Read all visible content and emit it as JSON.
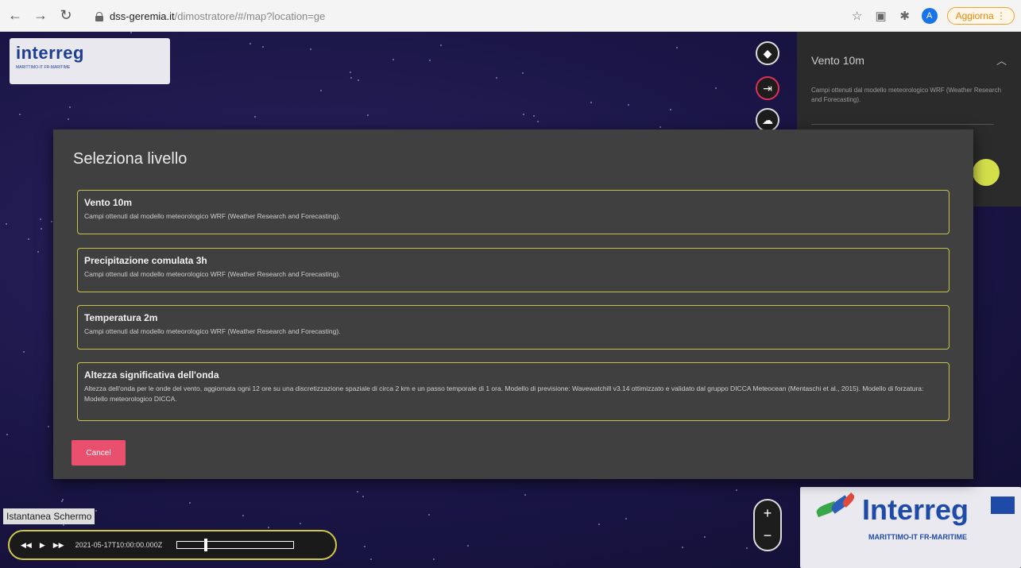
{
  "browser": {
    "url_host": "dss-geremia.it",
    "url_path": "/dimostratore/#/map?location=ge",
    "profile_initial": "A",
    "update_label": "Aggiorna"
  },
  "logo": {
    "small_word": "interreg",
    "small_sub": "MARITTIMO-IT FR-MARITIME",
    "big_word": "Interreg",
    "big_sub": "MARITTIMO-IT FR-MARITIME"
  },
  "side_panel": {
    "title": "Vento 10m",
    "description": "Campi ottenuti dal modello meteorologico WRF (Weather Research and Forecasting)."
  },
  "modal": {
    "title": "Seleziona livello",
    "layers": [
      {
        "name": "Vento 10m",
        "description": "Campi ottenuti dal modello meteorologico WRF (Weather Research and Forecasting)."
      },
      {
        "name": "Precipitazione comulata 3h",
        "description": "Campi ottenuti dal modello meteorologico WRF (Weather Research and Forecasting)."
      },
      {
        "name": "Temperatura 2m",
        "description": "Campi ottenuti dal modello meteorologico WRF (Weather Research and Forecasting)."
      },
      {
        "name": "Altezza significativa dell'onda",
        "description": "Altezza dell'onda per le onde del vento, aggiornata ogni 12 ore su una discretizzazione spaziale di circa 2 km e un passo temporale di 1 ora. Modello di previsione: Wavewatchill v3.14 ottimizzato e validato dal gruppo DICCA Meteocean (Mentaschi et al., 2015). Modello di forzatura: Modello meteorologico DICCA."
      }
    ],
    "cancel_label": "Cancel"
  },
  "map_controls": {
    "zoom_in": "+",
    "zoom_out": "−"
  },
  "player": {
    "snapshot_label": "Istantanea Schermo",
    "timestamp": "2021-05-17T10:00:00.000Z"
  }
}
